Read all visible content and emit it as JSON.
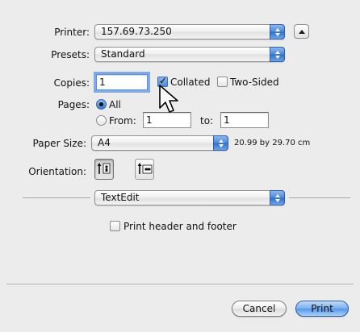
{
  "printer": {
    "label": "Printer:",
    "value": "157.69.73.250"
  },
  "presets": {
    "label": "Presets:",
    "value": "Standard"
  },
  "copies": {
    "label": "Copies:",
    "value": "1",
    "collated_label": "Collated",
    "collated_checked": true,
    "two_sided_label": "Two-Sided",
    "two_sided_checked": false
  },
  "pages": {
    "label": "Pages:",
    "all_label": "All",
    "all_selected": true,
    "from_label": "From:",
    "from_value": "1",
    "to_label": "to:",
    "to_value": "1"
  },
  "paper": {
    "label": "Paper Size:",
    "value": "A4",
    "dimensions": "20.99 by 29.70 cm"
  },
  "orientation": {
    "label": "Orientation:",
    "options": [
      "portrait",
      "landscape"
    ],
    "selected": "portrait"
  },
  "section": {
    "value": "TextEdit"
  },
  "header_footer": {
    "label": "Print header and footer",
    "checked": false
  },
  "buttons": {
    "cancel": "Cancel",
    "print": "Print"
  },
  "icons": {
    "printer_arrows": "popup-arrows-icon",
    "disclosure": "disclosure-triangle-icon",
    "portrait": "portrait-orientation-icon",
    "landscape": "landscape-orientation-icon",
    "cursor": "mouse-pointer-icon"
  },
  "colors": {
    "accent": "#4b87d9",
    "default_button": "#79aef0",
    "background": "#ececec"
  }
}
